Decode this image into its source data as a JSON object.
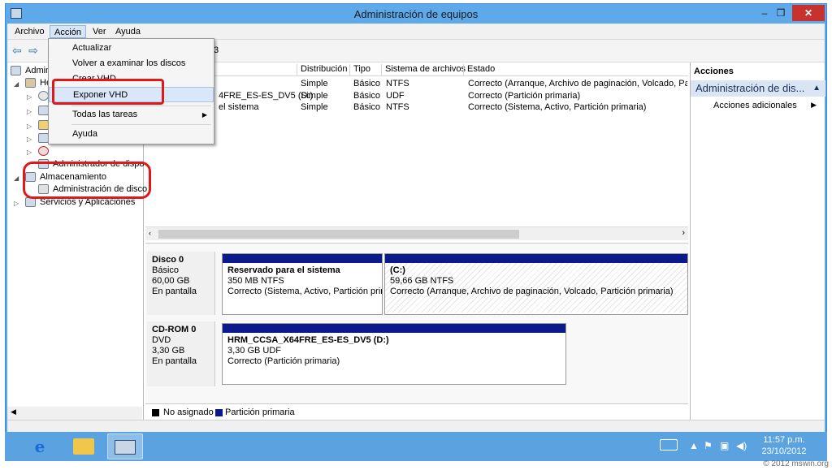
{
  "window": {
    "title": "Administración de equipos",
    "close_glyph": "✕",
    "max_glyph": "❐",
    "min_glyph": "–"
  },
  "menubar": [
    "Archivo",
    "Acción",
    "Ver",
    "Ayuda"
  ],
  "toolbar": {
    "back_glyph": "⇦",
    "forward_glyph": "⇨",
    "path_fragment": "3"
  },
  "tree": [
    {
      "label": "Admin",
      "icon": "computer-icon"
    },
    {
      "label": "He",
      "icon": "tools-icon"
    },
    {
      "label": "",
      "icon": "clock-icon"
    },
    {
      "label": "",
      "icon": "event-viewer-icon"
    },
    {
      "label": "",
      "icon": "shared-folders-icon"
    },
    {
      "label": "",
      "icon": "users-icon"
    },
    {
      "label": "",
      "icon": "performance-icon"
    },
    {
      "label": "Administrador de dispo",
      "icon": "device-manager-icon"
    },
    {
      "label": "Almacenamiento",
      "icon": "storage-icon"
    },
    {
      "label": "Administración de disco",
      "icon": "disk-management-icon"
    },
    {
      "label": "Servicios y Aplicaciones",
      "icon": "services-icon"
    }
  ],
  "volume_table": {
    "columns": [
      "Distribución",
      "Tipo",
      "Sistema de archivos",
      "Estado"
    ],
    "rows": [
      {
        "name": "4FRE_ES-ES_DV5 (D:)",
        "layout": "Simple",
        "type": "Básico",
        "fs": "UDF",
        "status": "Correcto (Partición primaria)"
      },
      {
        "name": "el sistema",
        "layout": "Simple",
        "type": "Básico",
        "fs": "NTFS",
        "status": "Correcto (Sistema, Activo, Partición primaria)"
      }
    ],
    "first_row": {
      "layout": "Simple",
      "type": "Básico",
      "fs": "NTFS",
      "status": "Correcto (Arranque, Archivo de paginación, Volcado, Partici"
    }
  },
  "disks": [
    {
      "name": "Disco 0",
      "kind": "Básico",
      "size": "60,00 GB",
      "state": "En pantalla",
      "partitions": [
        {
          "title": "Reservado para el sistema",
          "line2": "350 MB NTFS",
          "line3": "Correcto (Sistema, Activo, Partición prim"
        },
        {
          "title": "(C:)",
          "line2": "59,66 GB NTFS",
          "line3": "Correcto (Arranque, Archivo de paginación, Volcado, Partición primaria)"
        }
      ]
    },
    {
      "name": "CD-ROM 0",
      "kind": "DVD",
      "size": "3,30 GB",
      "state": "En pantalla",
      "partitions": [
        {
          "title": "HRM_CCSA_X64FRE_ES-ES_DV5  (D:)",
          "line2": "3,30 GB UDF",
          "line3": "Correcto (Partición primaria)"
        }
      ]
    }
  ],
  "legend": [
    {
      "label": "No asignado",
      "color": "#000000"
    },
    {
      "label": "Partición primaria",
      "color": "#0a1a8c"
    }
  ],
  "actions": {
    "title": "Acciones",
    "section": "Administración de dis...",
    "item": "Acciones adicionales"
  },
  "action_menu": {
    "items": [
      "Actualizar",
      "Volver a examinar los discos",
      "Crear VHD",
      "Exponer VHD",
      "Todas las tareas",
      "Ayuda"
    ],
    "highlighted": "Exponer VHD"
  },
  "taskbar": {
    "time": "11:57 p.m.",
    "date": "23/10/2012"
  },
  "watermark": "© 2012 mswin.org",
  "colors": {
    "callout": "#e01818",
    "partition_bar": "#0a1a8c",
    "titlebar": "#5ea9ea",
    "taskbar": "#5ba2e0"
  }
}
